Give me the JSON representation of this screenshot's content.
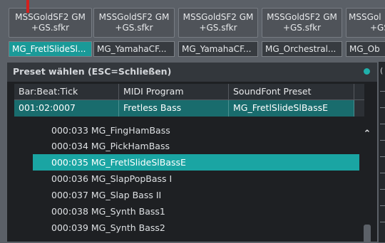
{
  "soundfont_tabs": [
    {
      "line1": "MSSGoldSF2 GM",
      "line2": "+GS.sfkr"
    },
    {
      "line1": "MSSGoldSF2 GM",
      "line2": "+GS.sfkr"
    },
    {
      "line1": "MSSGoldSF2 GM",
      "line2": "+GS.sfkr"
    },
    {
      "line1": "MSSGoldSF2 GM",
      "line2": "+GS.sfkr"
    },
    {
      "line1": "MSSGol",
      "line2": "+GS"
    }
  ],
  "preset_tabs": [
    {
      "label": "MG_FretlSlideSl..."
    },
    {
      "label": "MG_YamahaCF..."
    },
    {
      "label": "MG_YamahaCF..."
    },
    {
      "label": "MG_Orchestral..."
    },
    {
      "label": "MG_Ob"
    }
  ],
  "dialog": {
    "title": "Preset wählen (ESC=Schließen)",
    "accent_color": "#1fb0ab",
    "columns": [
      "Bar:Beat:Tick",
      "MIDI Program",
      "SoundFont Preset"
    ],
    "row": [
      "001:02:0007",
      "Fretless Bass",
      "MG_FretlSlideSlBassE"
    ],
    "list": [
      "000:033 MG_FingHamBass",
      "000:034 MG_PickHamBass",
      "000:035 MG_FretlSlideSlBassE",
      "000:036 MG_SlapPopBass I",
      "000:037 MG_Slap Bass II",
      "000:038 MG_Synth Bass1",
      "000:039 MG_Synth Bass2"
    ],
    "selected_index": 2
  },
  "right_panel": {
    "label": "("
  }
}
